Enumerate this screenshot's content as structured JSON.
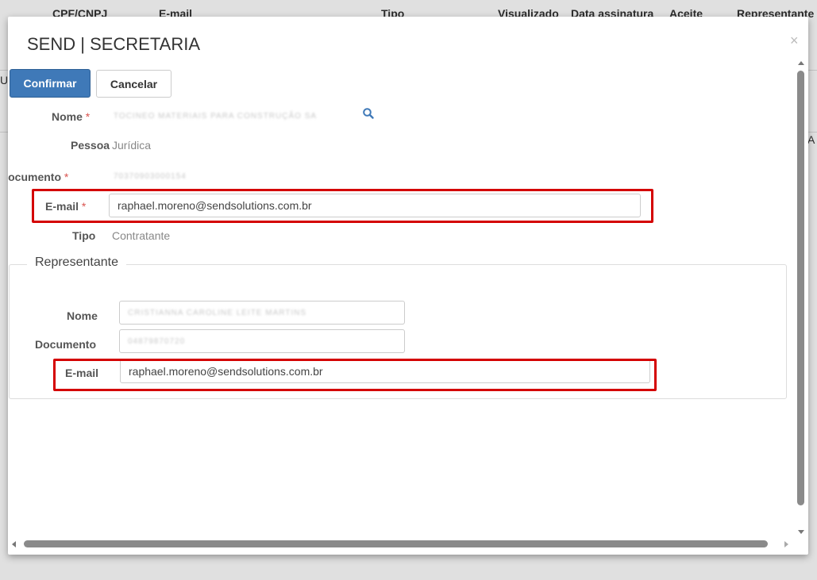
{
  "background": {
    "columns": [
      "CPF/CNPJ",
      "E-mail",
      "Tipo",
      "Visualizado",
      "Data assinatura",
      "Aceite",
      "Representante"
    ],
    "left_edge_text": "U",
    "right_edge_text": "A"
  },
  "modal": {
    "title": "SEND | SECRETARIA",
    "close_glyph": "×",
    "confirm_label": "Confirmar",
    "cancel_label": "Cancelar",
    "required_mark": "*",
    "fields": {
      "nome_label": "Nome",
      "nome_value": "TOCINEO MATERIAIS PARA CONSTRUÇÃO SA",
      "pessoa_label": "Pessoa",
      "pessoa_value": "Jurídica",
      "documento_label": "Documento",
      "documento_value": "70370903000154",
      "email_label": "E-mail",
      "email_value": "raphael.moreno@sendsolutions.com.br",
      "tipo_label": "Tipo",
      "tipo_value": "Contratante"
    },
    "representante": {
      "legend": "Representante",
      "nome_label": "Nome",
      "nome_value": "CRISTIANNA CAROLINE LEITE MARTINS",
      "documento_label": "Documento",
      "documento_value": "04879870720",
      "email_label": "E-mail",
      "email_value": "raphael.moreno@sendsolutions.com.br"
    },
    "highlight_color": "#d40000",
    "primary_color": "#3f79b8"
  }
}
